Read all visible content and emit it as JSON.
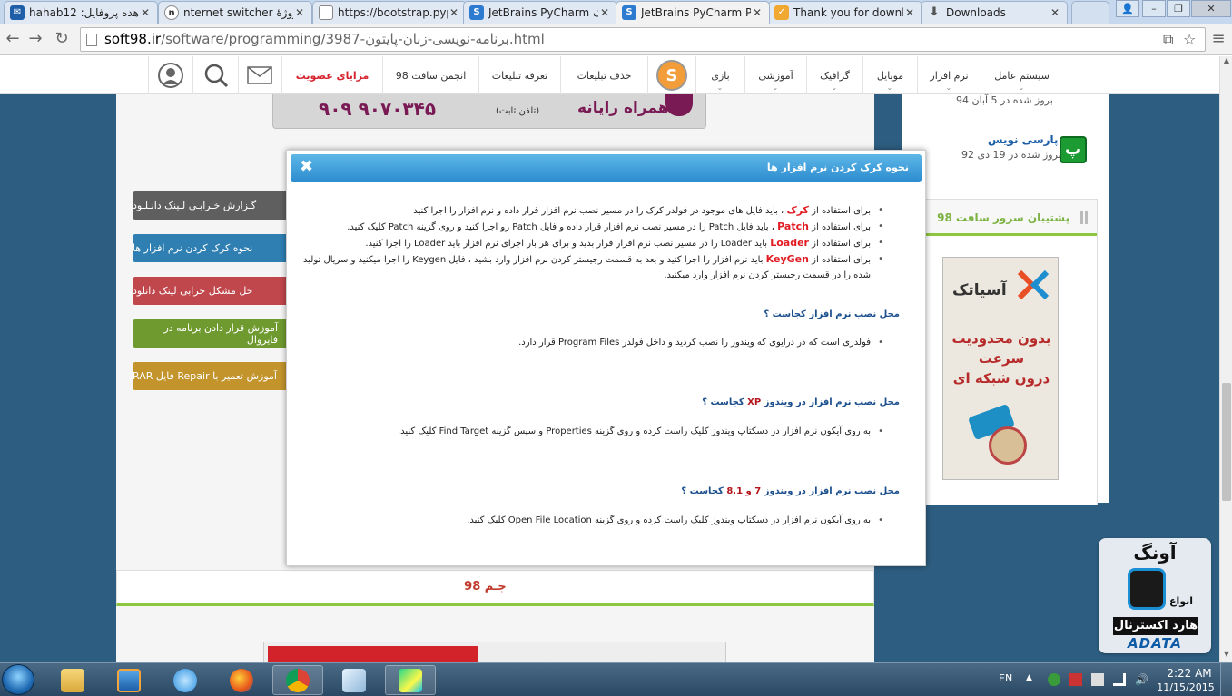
{
  "browser": {
    "tabs": [
      {
        "title": "hahab12 :مشاهده پروفایل",
        "fav_color": "#1f5fa8",
        "fav_char": "✉"
      },
      {
        "title": "nternet switcher پروژهٔ",
        "fav_color": "#ffffff",
        "fav_char": "n"
      },
      {
        "title": "https://bootstrap.pyp",
        "fav_color": "#ffffff",
        "fav_char": ""
      },
      {
        "title": "JetBrains PyCharm کرک",
        "fav_color": "#2c7bd1",
        "fav_char": "S"
      },
      {
        "title": "JetBrains PyCharm Pr",
        "fav_color": "#2c7bd1",
        "fav_char": "S"
      },
      {
        "title": "Thank you for downl",
        "fav_color": "#f0a830",
        "fav_char": "✓"
      },
      {
        "title": "Downloads",
        "fav_color": "#ffffff",
        "fav_char": "⬇"
      }
    ],
    "active_tab": 4,
    "url_host": "soft98.ir",
    "url_path": "/software/programming/3987-برنامه-نویسی-زبان-پایتون.html"
  },
  "site_nav": {
    "items": [
      "سیستم عامل",
      "نرم افزار",
      "موبایل",
      "گرافیک",
      "آموزشی",
      "بازی",
      "حذف تبلیغات",
      "تعرفه تبلیغات",
      "انجمن سافت 98",
      "مزایای عضویت"
    ]
  },
  "promo": {
    "phone": "۹۰۹ ۹۰۷۰۳۴۵",
    "fixed": "(تلفن ثابت)",
    "brand": "همراه رایانه"
  },
  "side_buttons": [
    {
      "label": "گـزارش خـرابـی لـینک دانـلـود",
      "color": "#5f5f5f"
    },
    {
      "label": "نحوه کرک کردن نرم افزار ها",
      "color": "#2f7fb3"
    },
    {
      "label": "حل مشکل خرابی لینک دانلود",
      "color": "#c0474c"
    },
    {
      "label": "آموزش قرار دادن برنامه در فایروال",
      "color": "#6f9a2f"
    },
    {
      "label": "آموزش تعمیر با Repair فایل RAR",
      "color": "#c3942c"
    }
  ],
  "right_col": {
    "top_sub": "بروز شده در 5 آبان 94",
    "link": "پارسی نویس",
    "sub": "بروز شده در 19 دی 92",
    "support_title": "پشتیبان سرور سافت 98"
  },
  "asiatech_ad": {
    "brand": "آسیاتک",
    "slogan": [
      "بدون محدودیت",
      "سرعت",
      "درون شبکه ای"
    ]
  },
  "adata_ad": {
    "title": "آونگ",
    "types": "انواع",
    "label": "هارد اکسترنال",
    "brand": "ADATA"
  },
  "footer": {
    "text": "جـم 98"
  },
  "modal": {
    "title": "نحوه کرک کردن نرم افزار ها",
    "crack_items": [
      {
        "pre": "برای استفاده از",
        "kw": "کرک",
        "post": "، باید فایل های موجود در فولدر کرک را در مسیر نصب نرم افزار قرار داده و نرم افزار را اجرا کنید"
      },
      {
        "pre": "برای استفاده از",
        "kw": "Patch",
        "post": "، باید فایل Patch را در مسیر نصب نرم افزار قرار داده و فایل Patch رو اجرا کنید و روی گزینه Patch کلیک کنید."
      },
      {
        "pre": "برای استفاده از",
        "kw": "Loader",
        "post": "باید Loader را در مسیر نصب نرم افزار قرار بدید و برای هر بار اجرای نرم افزار باید Loader را اجرا کنید."
      },
      {
        "pre": "برای استفاده از",
        "kw": "KeyGen",
        "post": "باید نرم افزار را اجرا کنید و بعد به قسمت رجیستر کردن نرم افزار وارد بشید ، فایل Keygen را اجرا میکنید و سریال تولید شده را در قسمت رجیستر کردن نرم افزار وارد میکنید."
      }
    ],
    "q1": "محل نصب نرم افزار کجاست ؟",
    "a1": "فولدری است که در درایوی که ویندوز را نصب کردید و داخل فولدر Program Files قرار دارد.",
    "q2_pre": "محل نصب نرم افزار در ویندوز",
    "q2_hl": "XP",
    "q2_post": "کجاست ؟",
    "a2": "به روی آیکون نرم افزار در دسکتاپ ویندوز کلیک راست کرده و روی گزینه Properties و سپس گزینه Find Target کلیک کنید.",
    "q3_pre": "محل نصب نرم افزار در ویندوز",
    "q3_hl": "7 و 8.1",
    "q3_post": "کجاست ؟",
    "a3": "به روی آیکون نرم افزار در دسکتاپ ویندوز کلیک راست کرده و روی گزینه Open File Location کلیک کنید.",
    "close_glyph": "✖"
  },
  "taskbar": {
    "apps": [
      "file-explorer",
      "media-player",
      "internet-explorer",
      "firefox",
      "chrome",
      "notepad",
      "pycharm"
    ],
    "lang": "EN",
    "time": "2:22 AM",
    "date": "11/15/2015"
  },
  "colors": {
    "page_bg": "#2d5d80",
    "modal_header": "#2c8bcf",
    "accent_green": "#8dc63f",
    "keyword_red": "#e11b22"
  }
}
